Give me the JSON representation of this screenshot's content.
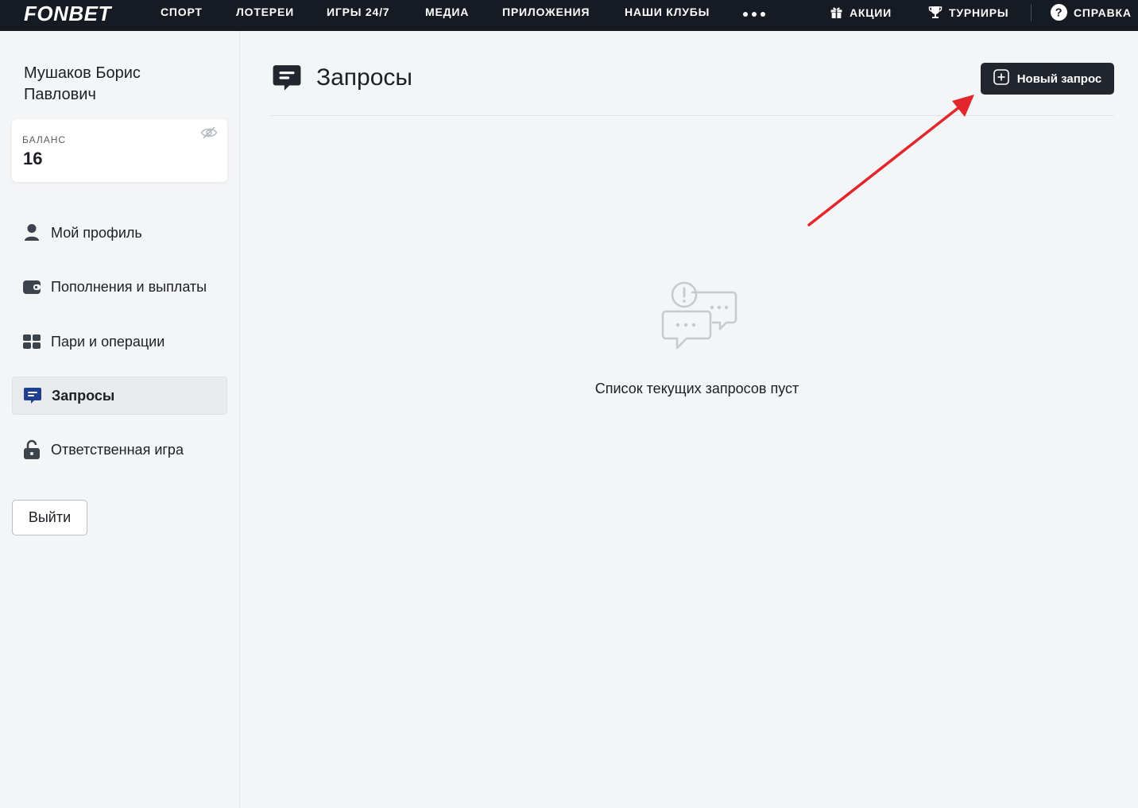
{
  "header": {
    "logo": "FONBET",
    "nav": [
      "СПОРТ",
      "ЛОТЕРЕИ",
      "ИГРЫ 24/7",
      "МЕДИА",
      "ПРИЛОЖЕНИЯ",
      "НАШИ КЛУБЫ"
    ],
    "more_icon": "more-dots-icon",
    "right": {
      "promo": "АКЦИИ",
      "tournaments": "ТУРНИРЫ",
      "help": "СПРАВКА"
    }
  },
  "sidebar": {
    "user_name": "Мушаков Борис Павлович",
    "balance": {
      "label": "БАЛАНС",
      "value": "16"
    },
    "items": [
      {
        "label": "Мой профиль",
        "icon": "user-icon",
        "active": false
      },
      {
        "label": "Пополнения и выплаты",
        "icon": "wallet-icon",
        "active": false
      },
      {
        "label": "Пари и операции",
        "icon": "tickets-icon",
        "active": false
      },
      {
        "label": "Запросы",
        "icon": "chat-icon",
        "active": true
      },
      {
        "label": "Ответственная игра",
        "icon": "lock-icon",
        "active": false
      }
    ],
    "logout": "Выйти"
  },
  "main": {
    "title": "Запросы",
    "new_request": "Новый запрос",
    "empty_text": "Список текущих запросов пуст"
  },
  "colors": {
    "topbar": "#161a22",
    "accent_blue": "#1f3f8f",
    "button_dark": "#22262e",
    "annotation_arrow": "#e3262b"
  }
}
